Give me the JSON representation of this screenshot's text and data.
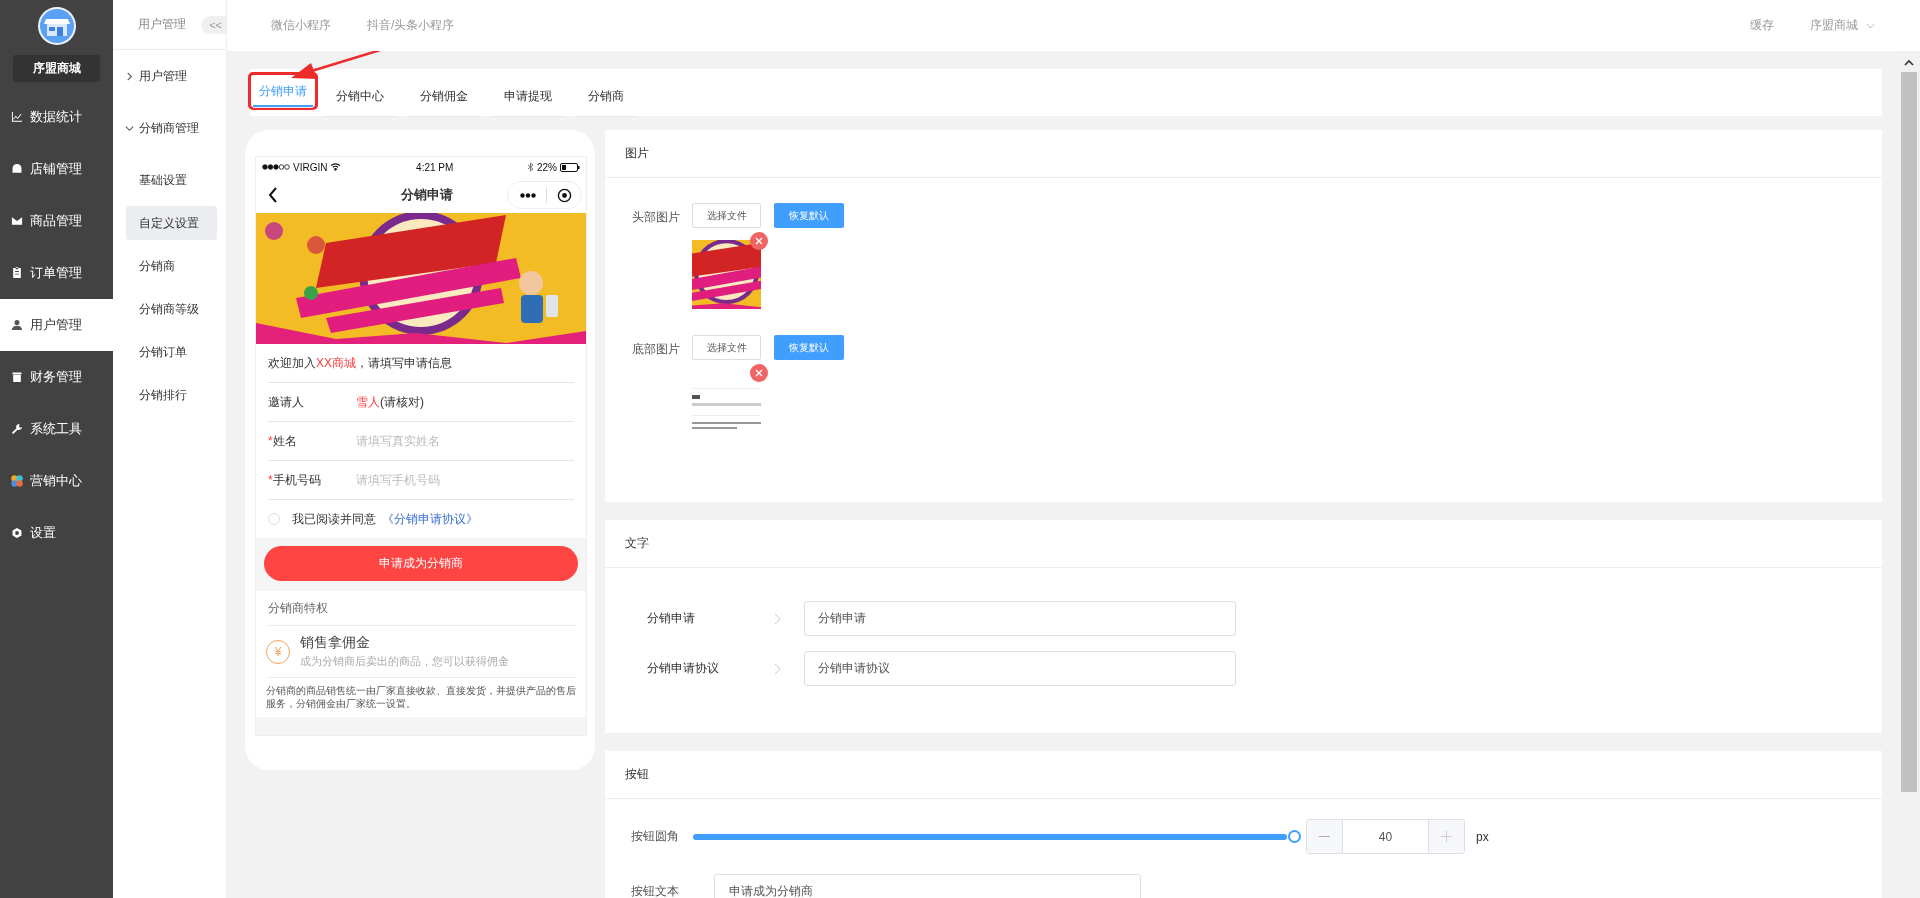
{
  "sidebar": {
    "brand": "序盟商城",
    "items": [
      {
        "label": "数据统计",
        "selected": false
      },
      {
        "label": "店铺管理",
        "selected": false
      },
      {
        "label": "商品管理",
        "selected": false
      },
      {
        "label": "订单管理",
        "selected": false
      },
      {
        "label": "用户管理",
        "selected": true
      },
      {
        "label": "财务管理",
        "selected": false
      },
      {
        "label": "系统工具",
        "selected": false
      },
      {
        "label": "营销中心",
        "selected": false
      },
      {
        "label": "设置",
        "selected": false
      }
    ]
  },
  "submenu": {
    "title": "用户管理",
    "collapse": "<<",
    "groups": [
      {
        "label": "用户管理",
        "expanded": false
      },
      {
        "label": "分销商管理",
        "expanded": true,
        "children": [
          {
            "label": "基础设置",
            "selected": false
          },
          {
            "label": "自定义设置",
            "selected": true
          },
          {
            "label": "分销商",
            "selected": false
          },
          {
            "label": "分销商等级",
            "selected": false
          },
          {
            "label": "分销订单",
            "selected": false
          },
          {
            "label": "分销排行",
            "selected": false
          }
        ]
      }
    ]
  },
  "top_tabs": [
    {
      "label": "微信小程序"
    },
    {
      "label": "抖音/头条小程序"
    }
  ],
  "top_actions": {
    "cache": "缓存",
    "user": "序盟商城"
  },
  "tabs": [
    {
      "label": "分销申请",
      "selected": true
    },
    {
      "label": "分销中心",
      "selected": false
    },
    {
      "label": "分销佣金",
      "selected": false
    },
    {
      "label": "申请提现",
      "selected": false
    },
    {
      "label": "分销商",
      "selected": false
    }
  ],
  "preview": {
    "status": {
      "carrier": "VIRGIN",
      "time": "4:21 PM",
      "battery": "22%"
    },
    "title": "分销申请",
    "welcome": {
      "prefix": "欢迎加入",
      "highlight": "XX商城",
      "suffix": "，请填写申请信息"
    },
    "inviter": {
      "label": "邀请人",
      "highlight": "雪人",
      "suffix": "(请核对)"
    },
    "fields": [
      {
        "mark": "*",
        "label": "姓名",
        "placeholder": "请填写真实姓名"
      },
      {
        "mark": "*",
        "label": "手机号码",
        "placeholder": "请填写手机号码"
      }
    ],
    "agreement": {
      "checked": false,
      "text": "我已阅读并同意",
      "link": "《分销申请协议》"
    },
    "submit": "申请成为分销商",
    "privileges": {
      "title": "分销商特权",
      "items": [
        {
          "icon": "¥",
          "title": "销售拿佣金",
          "desc": "成为分销商后卖出的商品，您可以获得佣金"
        }
      ]
    },
    "note": "分销商的商品销售统一由厂家直接收款、直接发货，并提供产品的售后服务，分销佣金由厂家统一设置。"
  },
  "image_panel": {
    "title": "图片",
    "rows": [
      {
        "label": "头部图片",
        "choose": "选择文件",
        "reset": "恢复默认"
      },
      {
        "label": "底部图片",
        "choose": "选择文件",
        "reset": "恢复默认"
      }
    ]
  },
  "text_panel": {
    "title": "文字",
    "fields": [
      {
        "label": "分销申请",
        "value": "分销申请"
      },
      {
        "label": "分销申请协议",
        "value": "分销申请协议"
      }
    ]
  },
  "button_panel": {
    "title": "按钮",
    "radius": {
      "label": "按钮圆角",
      "level": 1.0,
      "value": "40",
      "unit": "px"
    },
    "text_field": {
      "label": "按钮文本",
      "value": "申请成为分销商"
    }
  }
}
